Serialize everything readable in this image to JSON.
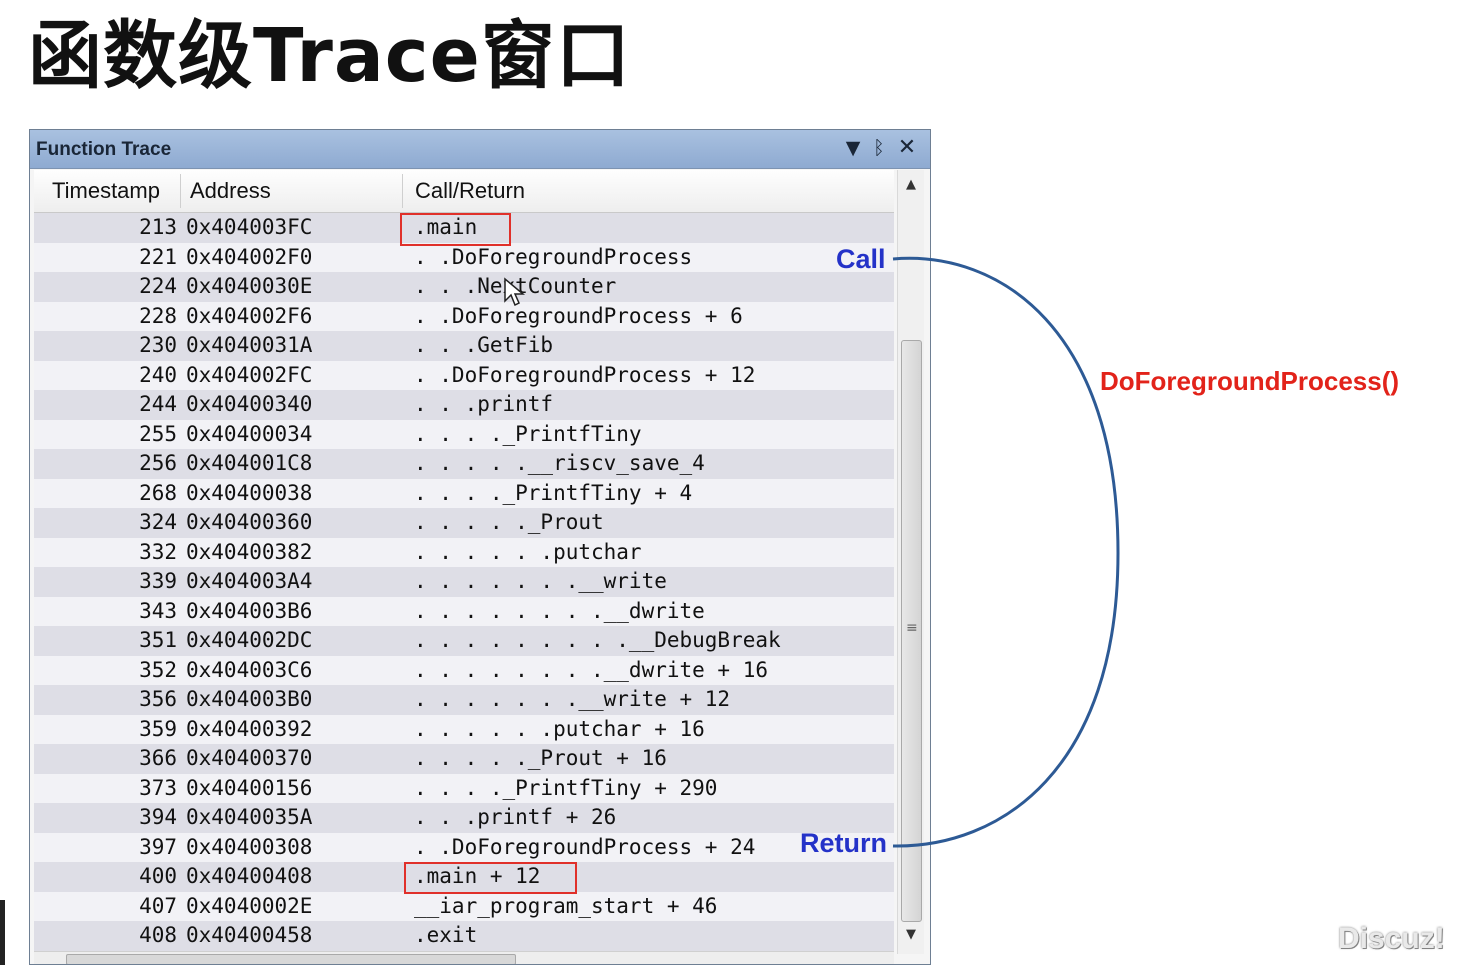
{
  "slide": {
    "title": "函数级Trace窗口"
  },
  "window": {
    "title": "Function Trace",
    "buttons": {
      "dropdown_icon": "▼",
      "pin_icon": "ᛒ",
      "close_icon": "✕"
    }
  },
  "columns": {
    "timestamp": "Timestamp",
    "address": "Address",
    "call_return": "Call/Return"
  },
  "rows": [
    {
      "ts": "213",
      "addr": "0x404003FC",
      "call": ".main"
    },
    {
      "ts": "221",
      "addr": "0x404002F0",
      "call": ". .DoForegroundProcess"
    },
    {
      "ts": "224",
      "addr": "0x4040030E",
      "call": ". . .NextCounter"
    },
    {
      "ts": "228",
      "addr": "0x404002F6",
      "call": ". .DoForegroundProcess + 6"
    },
    {
      "ts": "230",
      "addr": "0x4040031A",
      "call": ". . .GetFib"
    },
    {
      "ts": "240",
      "addr": "0x404002FC",
      "call": ". .DoForegroundProcess + 12"
    },
    {
      "ts": "244",
      "addr": "0x40400340",
      "call": ". . .printf"
    },
    {
      "ts": "255",
      "addr": "0x40400034",
      "call": ". . . ._PrintfTiny"
    },
    {
      "ts": "256",
      "addr": "0x404001C8",
      "call": ". . . . .__riscv_save_4"
    },
    {
      "ts": "268",
      "addr": "0x40400038",
      "call": ". . . ._PrintfTiny + 4"
    },
    {
      "ts": "324",
      "addr": "0x40400360",
      "call": ". . . . ._Prout"
    },
    {
      "ts": "332",
      "addr": "0x40400382",
      "call": ". . . . . .putchar"
    },
    {
      "ts": "339",
      "addr": "0x404003A4",
      "call": ". . . . . . .__write"
    },
    {
      "ts": "343",
      "addr": "0x404003B6",
      "call": ". . . . . . . .__dwrite"
    },
    {
      "ts": "351",
      "addr": "0x404002DC",
      "call": ". . . . . . . . .__DebugBreak"
    },
    {
      "ts": "352",
      "addr": "0x404003C6",
      "call": ". . . . . . . .__dwrite + 16"
    },
    {
      "ts": "356",
      "addr": "0x404003B0",
      "call": ". . . . . . .__write + 12"
    },
    {
      "ts": "359",
      "addr": "0x40400392",
      "call": ". . . . . .putchar + 16"
    },
    {
      "ts": "366",
      "addr": "0x40400370",
      "call": ". . . . ._Prout + 16"
    },
    {
      "ts": "373",
      "addr": "0x40400156",
      "call": ". . . ._PrintfTiny + 290"
    },
    {
      "ts": "394",
      "addr": "0x4040035A",
      "call": ". . .printf + 26"
    },
    {
      "ts": "397",
      "addr": "0x40400308",
      "call": ". .DoForegroundProcess + 24"
    },
    {
      "ts": "400",
      "addr": "0x40400408",
      "call": ".main + 12"
    },
    {
      "ts": "407",
      "addr": "0x4040002E",
      "call": "__iar_program_start + 46"
    },
    {
      "ts": "408",
      "addr": "0x40400458",
      "call": ".exit"
    }
  ],
  "annotations": {
    "call": "Call",
    "return": "Return",
    "function": "DoForegroundProcess()",
    "colors": {
      "call_return": "#2432c8",
      "function": "#e2231a",
      "highlight_box": "#e0302a",
      "arc": "#2d5a95"
    }
  },
  "watermark": "Discuz!"
}
